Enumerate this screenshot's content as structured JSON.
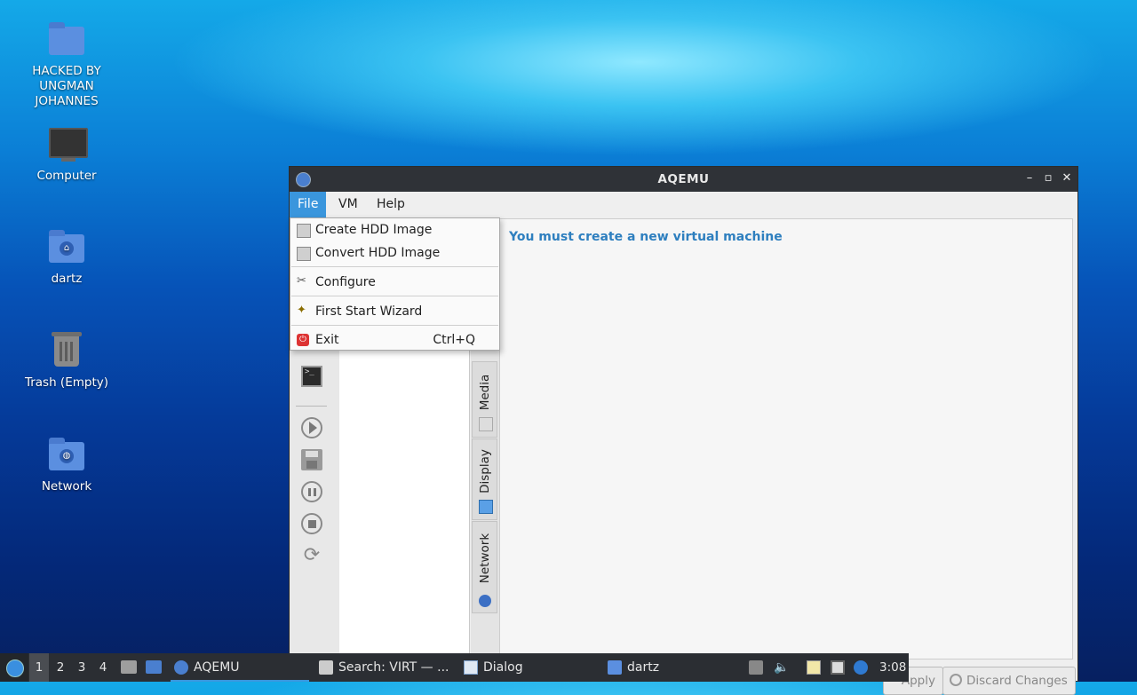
{
  "desktop": {
    "icons": [
      {
        "label": "HACKED BY UNGMAN JOHANNES",
        "icon": "folder-icon"
      },
      {
        "label": "Computer",
        "icon": "computer-icon"
      },
      {
        "label": "dartz",
        "icon": "home-folder-icon"
      },
      {
        "label": "Trash (Empty)",
        "icon": "trash-icon"
      },
      {
        "label": "Network",
        "icon": "network-folder-icon"
      }
    ]
  },
  "window": {
    "title": "AQEMU",
    "controls": {
      "minimize": "–",
      "restore": "▫",
      "close": "✕"
    },
    "menubar": [
      "File",
      "VM",
      "Help"
    ],
    "main_message": "You must create a new virtual machine",
    "side_tabs": [
      "Media",
      "Display",
      "Network"
    ],
    "bottom_buttons": [
      "Apply",
      "Discard Changes"
    ]
  },
  "file_menu": {
    "items": [
      {
        "label": "Create HDD Image",
        "shortcut": "",
        "icon": "disk-icon"
      },
      {
        "label": "Convert HDD Image",
        "shortcut": "",
        "icon": "disk-icon"
      },
      {
        "label": "Configure",
        "shortcut": "",
        "icon": "tools-icon"
      },
      {
        "label": "First Start Wizard",
        "shortcut": "",
        "icon": "wand-icon"
      },
      {
        "label": "Exit",
        "shortcut": "Ctrl+Q",
        "icon": "power-icon"
      }
    ]
  },
  "taskbar": {
    "desktops": [
      "1",
      "2",
      "3",
      "4"
    ],
    "tasks": [
      "AQEMU",
      "Search: VIRT — ...",
      "Dialog",
      "dartz"
    ],
    "clock": "3:08"
  },
  "colors": {
    "accent": "#3a96dd",
    "message": "#2e7fbf",
    "titlebar": "#2f3237",
    "taskbar": "#2b2e33"
  }
}
